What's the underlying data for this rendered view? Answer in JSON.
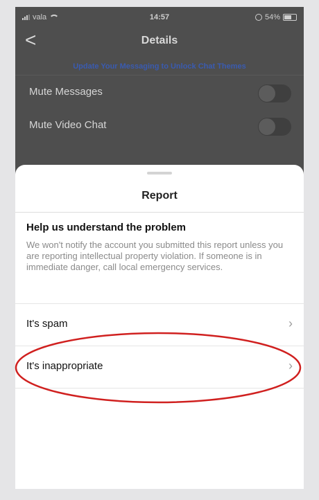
{
  "status_bar": {
    "carrier": "vala",
    "time": "14:57",
    "battery": "54%"
  },
  "header": {
    "title": "Details",
    "back_label": "<"
  },
  "banner": {
    "text": "Update Your Messaging to Unlock Chat Themes"
  },
  "settings": [
    {
      "label": "Mute Messages",
      "enabled": false
    },
    {
      "label": "Mute Video Chat",
      "enabled": false
    }
  ],
  "report_sheet": {
    "title": "Report",
    "heading": "Help us understand the problem",
    "body": "We won't notify the account you submitted this report unless you are reporting intellectual property violation. If someone is in immediate danger, call local emergency services.",
    "options": [
      {
        "label": "It's spam"
      },
      {
        "label": "It's inappropriate"
      }
    ]
  },
  "colors": {
    "backdrop": "#4e4e4e",
    "banner_link": "#3a5bb0",
    "annotation_ring": "#d0201f"
  }
}
